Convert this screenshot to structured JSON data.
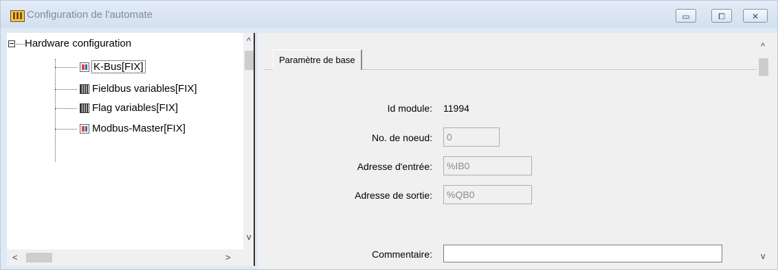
{
  "window": {
    "title": "Configuration de l'automate",
    "controls": {
      "minimize": "▭",
      "maximize": "⧠",
      "close": "✕"
    }
  },
  "tree": {
    "root": {
      "label": "Hardware configuration",
      "expanded": true
    },
    "items": [
      {
        "label": "K-Bus[FIX]",
        "icon": "module-icon",
        "selected": true
      },
      {
        "label": "Fieldbus variables[FIX]",
        "icon": "grid-icon"
      },
      {
        "label": "Flag variables[FIX]",
        "icon": "grid-icon"
      },
      {
        "label": "Modbus-Master[FIX]",
        "icon": "module-icon"
      }
    ],
    "scroll": {
      "up": "^",
      "down": "v",
      "left": "<",
      "right": ">"
    }
  },
  "details": {
    "tab": "Paramètre de base",
    "id_module": {
      "label": "Id module:",
      "value": "11994"
    },
    "node_no": {
      "label": "No. de noeud:",
      "value": "0"
    },
    "input_address": {
      "label": "Adresse d'entrée:",
      "value": "%IB0"
    },
    "output_address": {
      "label": "Adresse de sortie:",
      "value": "%QB0"
    },
    "comment": {
      "label": "Commentaire:",
      "value": ""
    },
    "scroll": {
      "up": "^",
      "down": "v"
    }
  }
}
